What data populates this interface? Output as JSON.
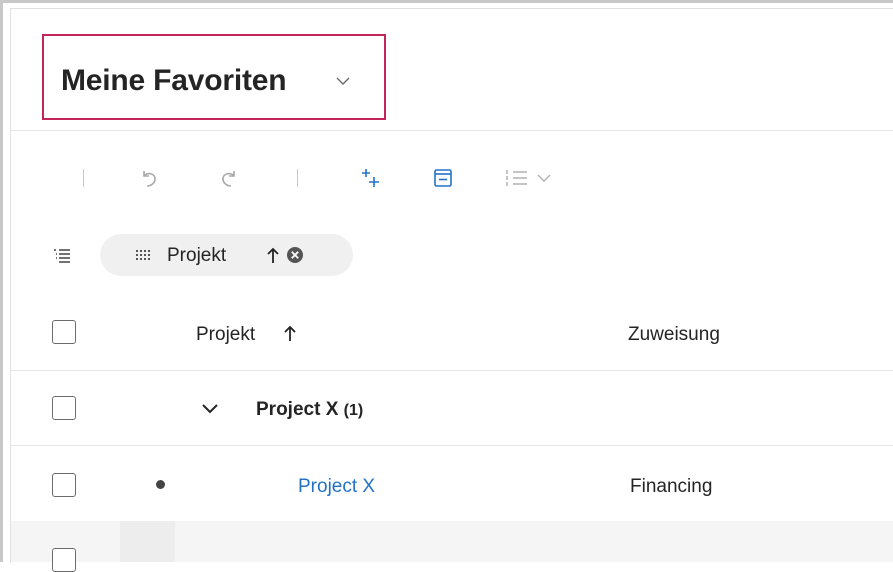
{
  "header": {
    "title": "Meine Favoriten",
    "title_highlight_color": "#c3245a",
    "dropdown_icon": "chevron-down-icon"
  },
  "toolbar": {
    "items": [
      {
        "name": "separator"
      },
      {
        "name": "undo-icon"
      },
      {
        "name": "redo-icon"
      },
      {
        "name": "separator"
      },
      {
        "name": "add-subitem-icon"
      },
      {
        "name": "collapse-icon"
      },
      {
        "name": "list-view-icon"
      },
      {
        "name": "chevron-down-icon"
      }
    ]
  },
  "grouping": {
    "icon": "group-by-icon",
    "chip": {
      "label": "Projekt",
      "grid_icon": "grid-dots-icon",
      "sort_icon": "arrow-up-icon",
      "clear_icon": "clear-circle-icon"
    }
  },
  "table": {
    "columns": [
      {
        "label": "Projekt",
        "sort": "ascending"
      },
      {
        "label": "Zuweisung"
      }
    ],
    "group_row": {
      "label": "Project X",
      "count": "(1)"
    },
    "rows": [
      {
        "projekt": "Project X",
        "zuweisung": "Financing"
      }
    ],
    "link_color": "#2472c8"
  }
}
